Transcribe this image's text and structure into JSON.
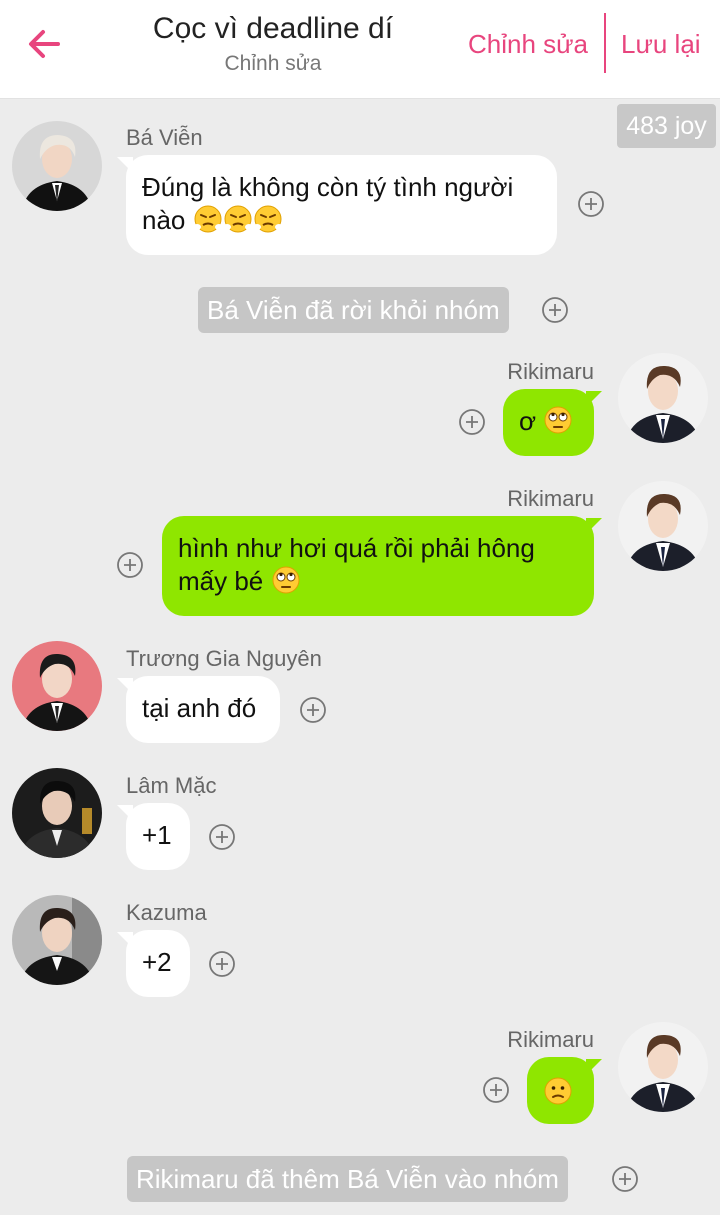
{
  "header": {
    "title": "Cọc vì deadline dí",
    "subtitle": "Chỉnh sửa",
    "edit_label": "Chỉnh sửa",
    "save_label": "Lưu lại"
  },
  "joy_badge": "483 joy",
  "messages": [
    {
      "type": "incoming",
      "sender": "Bá Viễn",
      "text": "Đúng là không còn tý tình người",
      "text2": "nào",
      "emojis": [
        "huffing-face",
        "huffing-face",
        "huffing-face"
      ]
    },
    {
      "type": "system",
      "text": "Bá Viễn đã rời khỏi nhóm"
    },
    {
      "type": "outgoing",
      "sender": "Rikimaru",
      "text": "ơ",
      "emojis": [
        "eye-roll-face"
      ]
    },
    {
      "type": "outgoing",
      "sender": "Rikimaru",
      "text": "hình như hơi quá rồi phải hông",
      "text2": "mấy bé",
      "emojis": [
        "eye-roll-face"
      ]
    },
    {
      "type": "incoming",
      "sender": "Trương Gia Nguyên",
      "text": "tại anh đó"
    },
    {
      "type": "incoming",
      "sender": "Lâm Mặc",
      "text": "+1"
    },
    {
      "type": "incoming",
      "sender": "Kazuma",
      "text": "+2"
    },
    {
      "type": "outgoing",
      "sender": "Rikimaru",
      "text": "",
      "emojis": [
        "confused-face"
      ]
    },
    {
      "type": "system",
      "text": "Rikimaru đã thêm Bá Viễn vào nhóm"
    }
  ],
  "colors": {
    "accent": "#e8457e",
    "outgoing_bubble": "#8fe600",
    "incoming_bubble": "#ffffff",
    "chat_background": "#ececec",
    "system_pill": "#c6c6c6"
  }
}
